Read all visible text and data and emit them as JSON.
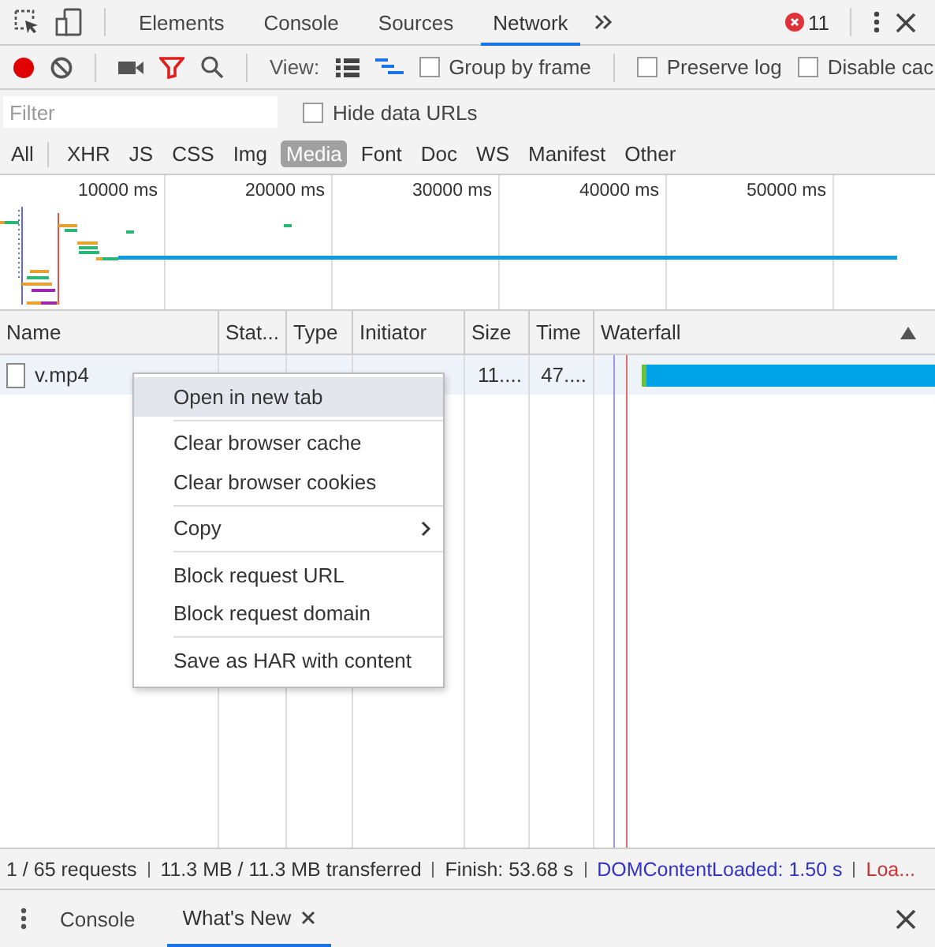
{
  "top_tabs": [
    {
      "label": "Elements",
      "selected": false
    },
    {
      "label": "Console",
      "selected": false
    },
    {
      "label": "Sources",
      "selected": false
    },
    {
      "label": "Network",
      "selected": true
    }
  ],
  "error_count": "11",
  "toolbar": {
    "recording": true,
    "view_label": "View:",
    "checkboxes": [
      {
        "label": "Group by frame",
        "checked": false
      },
      {
        "label": "Preserve log",
        "checked": false
      },
      {
        "label": "Disable cac",
        "checked": false
      }
    ]
  },
  "filter": {
    "placeholder": "Filter"
  },
  "hide_data_urls": {
    "label": "Hide data URLs",
    "checked": false
  },
  "type_filters": [
    {
      "label": "All",
      "selected": false
    },
    {
      "label": "XHR",
      "selected": false
    },
    {
      "label": "JS",
      "selected": false
    },
    {
      "label": "CSS",
      "selected": false
    },
    {
      "label": "Img",
      "selected": false
    },
    {
      "label": "Media",
      "selected": true
    },
    {
      "label": "Font",
      "selected": false
    },
    {
      "label": "Doc",
      "selected": false
    },
    {
      "label": "WS",
      "selected": false
    },
    {
      "label": "Manifest",
      "selected": false
    },
    {
      "label": "Other",
      "selected": false
    }
  ],
  "overview": {
    "ticks": [
      "10000 ms",
      "20000 ms",
      "30000 ms",
      "40000 ms",
      "50000 ms"
    ]
  },
  "columns": [
    "Name",
    "Stat...",
    "Type",
    "Initiator",
    "Size",
    "Time",
    "Waterfall"
  ],
  "rows": [
    {
      "name": "v.mp4",
      "size": "11....",
      "time": "47...."
    }
  ],
  "context_menu": [
    {
      "kind": "item",
      "label": "Open in new tab",
      "highlighted": true
    },
    {
      "kind": "separator"
    },
    {
      "kind": "item",
      "label": "Clear browser cache",
      "highlighted": false
    },
    {
      "kind": "item",
      "label": "Clear browser cookies",
      "highlighted": false
    },
    {
      "kind": "separator"
    },
    {
      "kind": "submenu",
      "label": "Copy",
      "highlighted": false
    },
    {
      "kind": "separator"
    },
    {
      "kind": "item",
      "label": "Block request URL",
      "highlighted": false
    },
    {
      "kind": "item",
      "label": "Block request domain",
      "highlighted": false
    },
    {
      "kind": "separator"
    },
    {
      "kind": "item",
      "label": "Save as HAR with content",
      "highlighted": false
    }
  ],
  "status_bar": [
    {
      "text": "1 / 65 requests",
      "color": "#333333"
    },
    {
      "text": "11.3 MB / 11.3 MB transferred",
      "color": "#333333"
    },
    {
      "text": "Finish: 53.68 s",
      "color": "#333333"
    },
    {
      "text": "DOMContentLoaded: 1.50 s",
      "color": "#3333cc"
    },
    {
      "text": "Loa...",
      "color": "#cc3333"
    }
  ],
  "drawer_tabs": [
    {
      "label": "Console",
      "selected": false,
      "closable": false
    },
    {
      "label": "What's New",
      "selected": true,
      "closable": true
    }
  ]
}
